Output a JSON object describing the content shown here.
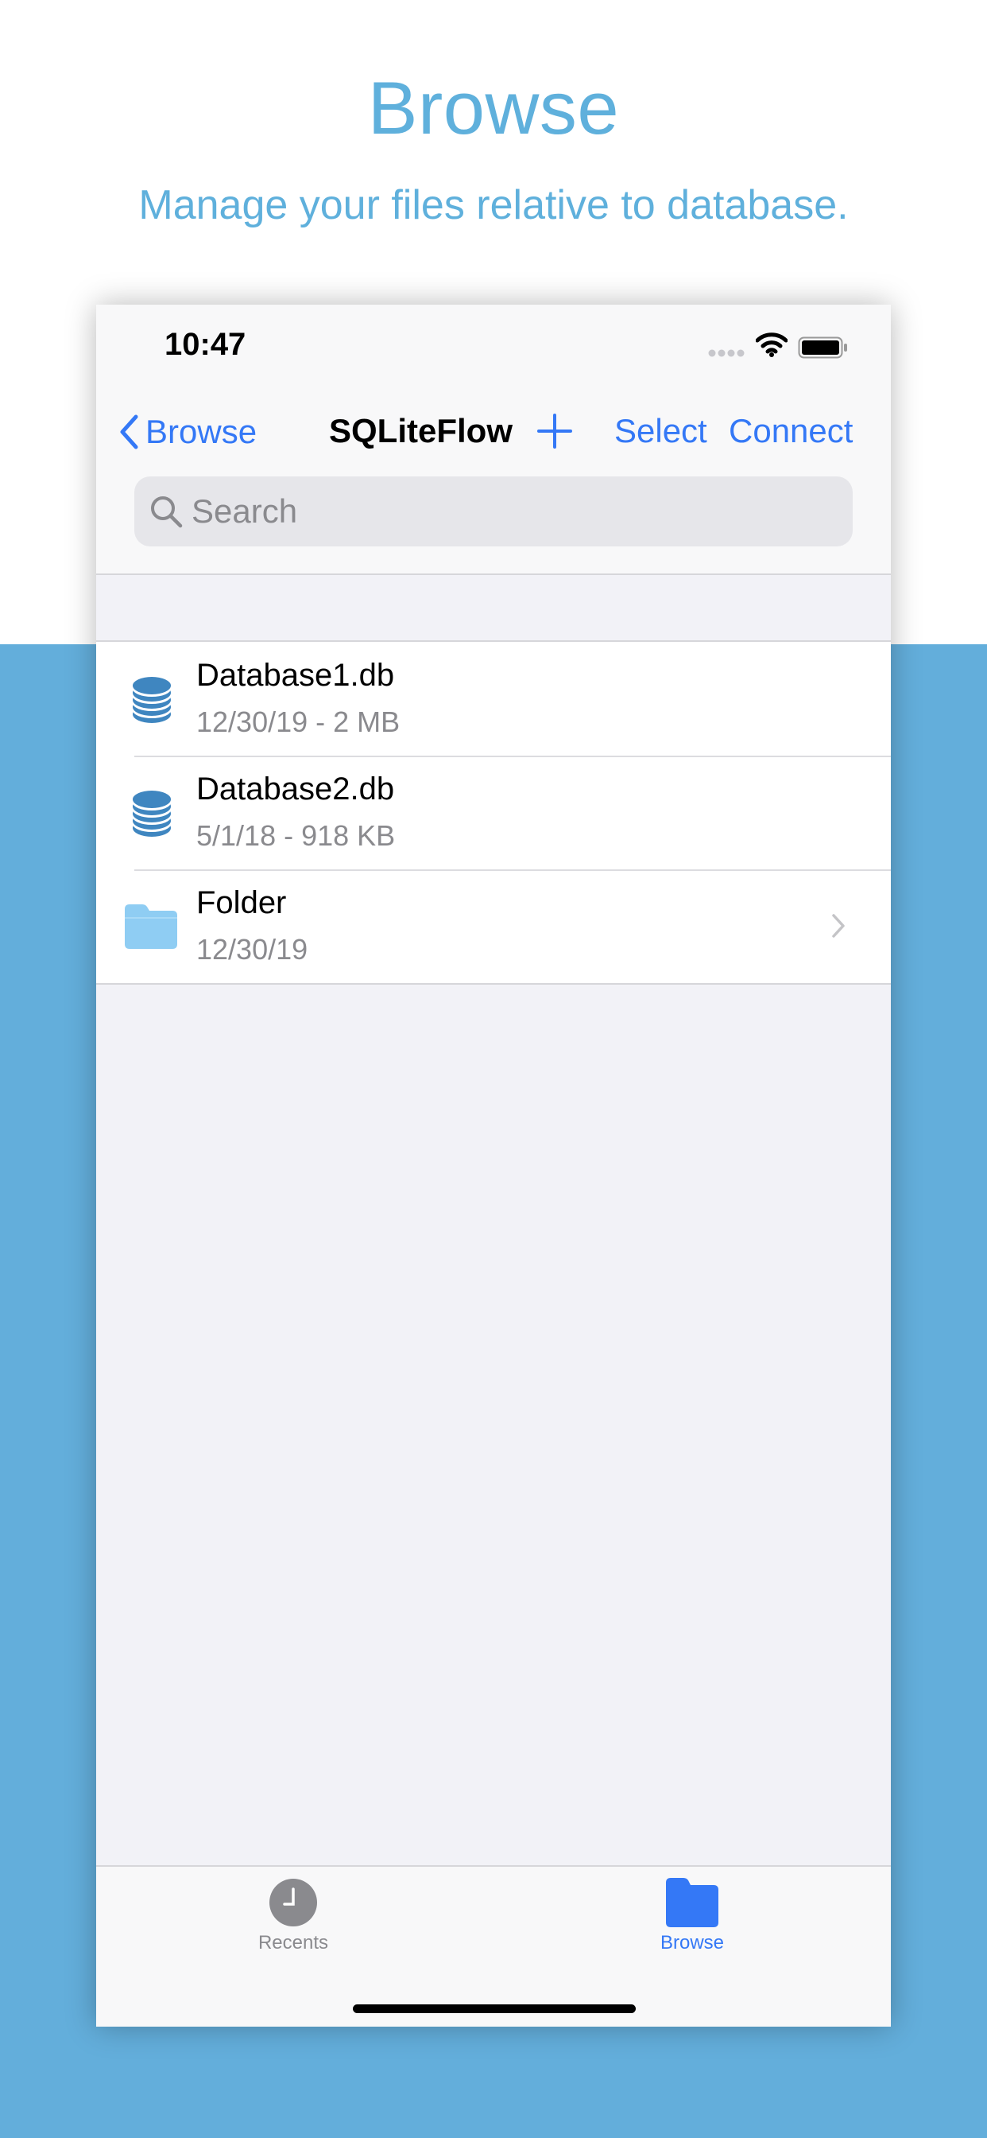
{
  "promo": {
    "title": "Browse",
    "subtitle": "Manage your files relative to database."
  },
  "status_bar": {
    "time": "10:47"
  },
  "nav": {
    "back_label": "Browse",
    "title": "SQLiteFlow",
    "select_label": "Select",
    "connect_label": "Connect"
  },
  "search": {
    "placeholder": "Search",
    "value": ""
  },
  "files": [
    {
      "name": "Database1.db",
      "meta": "12/30/19 - 2 MB",
      "icon": "database-icon"
    },
    {
      "name": "Database2.db",
      "meta": "5/1/18 - 918 KB",
      "icon": "database-icon"
    },
    {
      "name": "Folder",
      "meta": "12/30/19",
      "icon": "folder-icon"
    }
  ],
  "tabs": [
    {
      "label": "Recents",
      "icon": "clock-icon",
      "active": false
    },
    {
      "label": "Browse",
      "icon": "folder-icon",
      "active": true
    }
  ],
  "colors": {
    "accent": "#3478f6",
    "promo_text": "#5fb0dc",
    "background_band": "#63aedb",
    "database_icon": "#3f86c0",
    "folder_icon": "#8fcdf3",
    "inactive_tab": "#8a8a8e"
  }
}
